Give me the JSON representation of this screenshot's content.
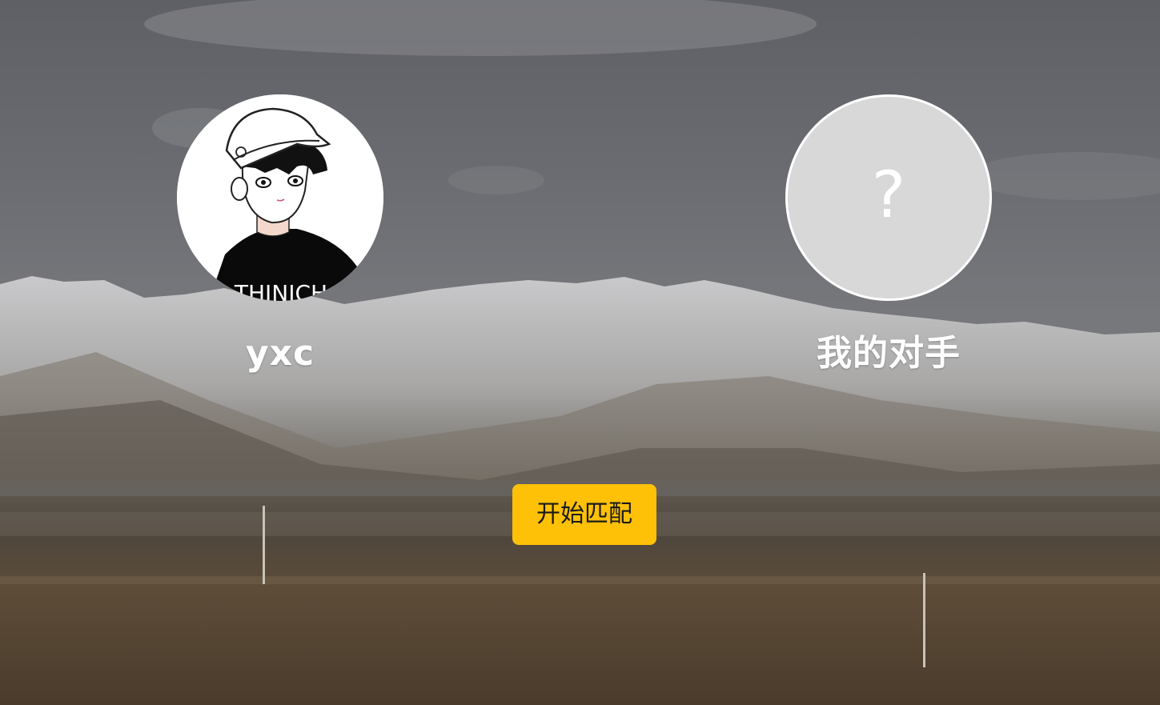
{
  "colors": {
    "button_bg": "#ffc107",
    "name_text": "#ffffff",
    "unknown_avatar_bg": "#d8d8d8"
  },
  "player": {
    "name": "yxc",
    "avatar_icon": "anime-boy-avatar"
  },
  "opponent": {
    "name": "我的对手",
    "placeholder": "?",
    "avatar_icon": "question-mark-icon"
  },
  "match_button": {
    "label": "开始匹配"
  },
  "avatar_shirt_text": "THINICH"
}
